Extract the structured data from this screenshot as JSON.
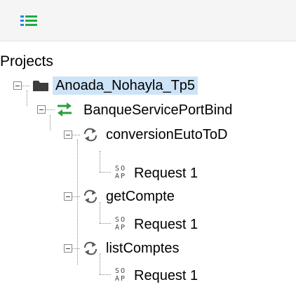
{
  "toolbar": {
    "icon": "tree-view-icon",
    "icon_color": "#1e88e5",
    "icon_color2": "#22aa44"
  },
  "tree": {
    "title": "Projects",
    "project": {
      "label": "Anoada_Nohayla_Tp5",
      "icon": "folder-icon",
      "selected": true,
      "binding": {
        "label": "BanqueServicePortBind",
        "icon": "swap-arrows-icon",
        "operations": [
          {
            "label": "conversionEutoToD",
            "icon": "refresh-icon",
            "request": {
              "label": "Request 1",
              "icon_line1": "SO",
              "icon_line2": "AP"
            }
          },
          {
            "label": "getCompte",
            "icon": "refresh-icon",
            "request": {
              "label": "Request 1",
              "icon_line1": "SO",
              "icon_line2": "AP"
            }
          },
          {
            "label": "listComptes",
            "icon": "refresh-icon",
            "request": {
              "label": "Request 1",
              "icon_line1": "SO",
              "icon_line2": "AP"
            }
          }
        ]
      }
    }
  },
  "colors": {
    "selection": "#cde3f7",
    "binding_icon": "#2e9e3e",
    "folder_icon": "#3d3d3d",
    "operation_icon": "#555555"
  }
}
